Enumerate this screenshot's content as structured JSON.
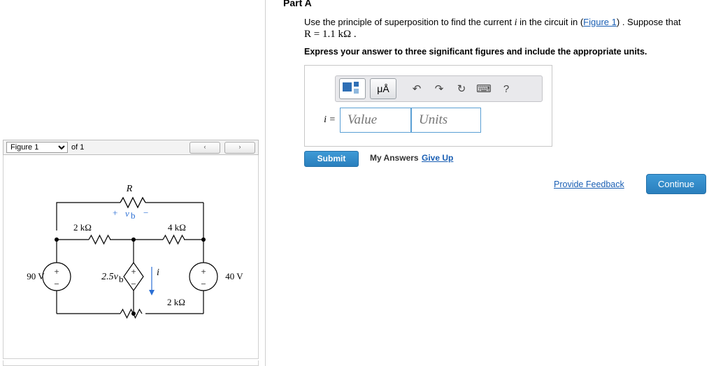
{
  "figure_panel": {
    "select_value": "Figure 1",
    "select_options": [
      "Figure 1"
    ],
    "of_label": "of 1",
    "prev_button": "‹",
    "next_button": "›"
  },
  "circuit": {
    "top_resistor_label": "R",
    "vb_plus": "+",
    "vb_label": "v",
    "vb_sub": "b",
    "vb_minus": "−",
    "left_resistor": "2 kΩ",
    "right_resistor": "4 kΩ",
    "bottom_resistor": "2 kΩ",
    "left_source": "90 V",
    "right_source": "40 V",
    "dependent_source": "2.5v",
    "dependent_source_sub": "b",
    "current_label": "i",
    "plus": "+",
    "minus": "−"
  },
  "part": {
    "title": "Part A",
    "question_pre": "Use the principle of superposition to find the current ",
    "question_i": "i",
    "question_mid": " in the circuit in (",
    "question_link": "Figure 1",
    "question_post": ") . Suppose that",
    "r_value": "R = 1.1  kΩ .",
    "instruction": "Express your answer to three significant figures and include the appropriate units."
  },
  "answer": {
    "toolbar": {
      "template_icon": "math-template-icon",
      "units_button": "μÅ",
      "undo_icon": "↶",
      "redo_icon": "↷",
      "reset_icon": "↻",
      "keyboard_icon": "⌨",
      "help_icon": "?"
    },
    "label": "i =",
    "value_placeholder": "Value",
    "units_placeholder": "Units"
  },
  "actions": {
    "submit": "Submit",
    "my_answers": "My Answers",
    "give_up": "Give Up",
    "provide_feedback": "Provide Feedback",
    "continue": "Continue"
  },
  "colors": {
    "accent_blue": "#2a7fbd",
    "link_blue": "#1a5fb4",
    "circuit_blue": "#2b6fd4"
  }
}
